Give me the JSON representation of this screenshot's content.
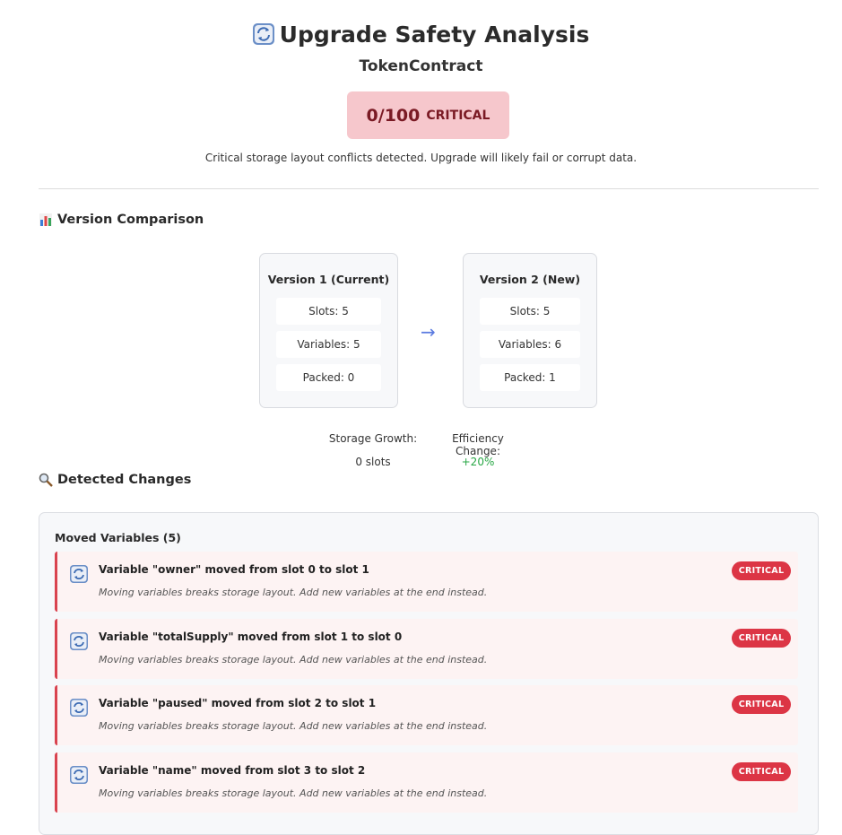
{
  "header": {
    "title": "Upgrade Safety Analysis",
    "contract_name": "TokenContract",
    "score": "0/100",
    "score_level": "CRITICAL",
    "summary": "Critical storage layout conflicts detected. Upgrade will likely fail or corrupt data."
  },
  "version_comparison": {
    "section_title": "Version Comparison",
    "current": {
      "title": "Version 1 (Current)",
      "stats": [
        "Slots: 5",
        "Variables: 5",
        "Packed: 0"
      ]
    },
    "new": {
      "title": "Version 2 (New)",
      "stats": [
        "Slots: 5",
        "Variables: 6",
        "Packed: 1"
      ]
    },
    "arrow": "→",
    "storage_growth_label": "Storage Growth:",
    "storage_growth_value": "0 slots",
    "efficiency_label": "Efficiency Change:",
    "efficiency_value": "+20%"
  },
  "changes": {
    "section_title": "Detected Changes",
    "group_title": "Moved Variables (5)",
    "items": [
      {
        "title": "Variable \"owner\" moved from slot 0 to slot 1",
        "description": "Moving variables breaks storage layout. Add new variables at the end instead.",
        "severity": "CRITICAL"
      },
      {
        "title": "Variable \"totalSupply\" moved from slot 1 to slot 0",
        "description": "Moving variables breaks storage layout. Add new variables at the end instead.",
        "severity": "CRITICAL"
      },
      {
        "title": "Variable \"paused\" moved from slot 2 to slot 1",
        "description": "Moving variables breaks storage layout. Add new variables at the end instead.",
        "severity": "CRITICAL"
      },
      {
        "title": "Variable \"name\" moved from slot 3 to slot 2",
        "description": "Moving variables breaks storage layout. Add new variables at the end instead.",
        "severity": "CRITICAL"
      }
    ]
  },
  "colors": {
    "critical": "#dc3545",
    "positive": "#28a745",
    "arrow": "#5b7be0"
  }
}
